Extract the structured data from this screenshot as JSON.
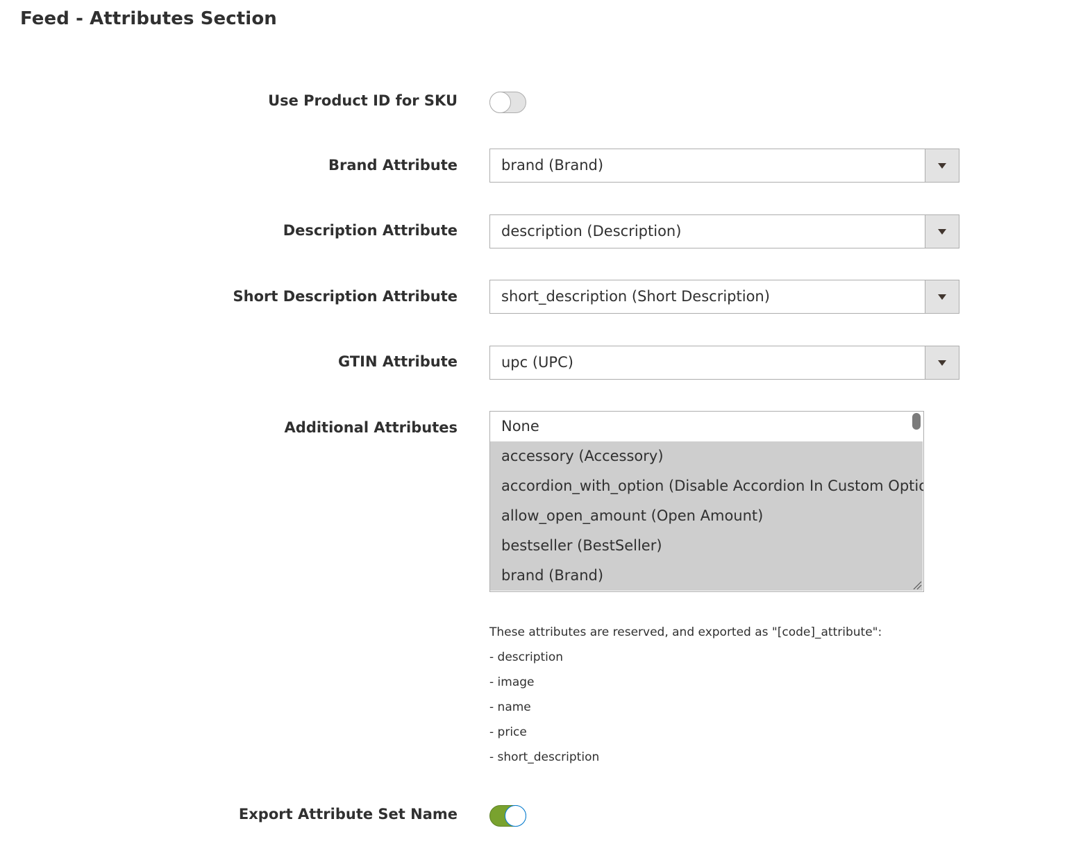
{
  "page": {
    "title": "Feed - Attributes Section"
  },
  "fields": {
    "use_product_id": {
      "label": "Use Product ID for SKU",
      "enabled": false
    },
    "brand": {
      "label": "Brand Attribute",
      "value": "brand (Brand)"
    },
    "description": {
      "label": "Description Attribute",
      "value": "description (Description)"
    },
    "short_description": {
      "label": "Short Description Attribute",
      "value": "short_description (Short Description)"
    },
    "gtin": {
      "label": "GTIN Attribute",
      "value": "upc (UPC)"
    },
    "additional": {
      "label": "Additional Attributes",
      "options": [
        {
          "text": "None",
          "selected": false
        },
        {
          "text": "accessory (Accessory)",
          "selected": true
        },
        {
          "text": "accordion_with_option (Disable Accordion In Custom Option)",
          "selected": true
        },
        {
          "text": "allow_open_amount (Open Amount)",
          "selected": true
        },
        {
          "text": "bestseller (BestSeller)",
          "selected": true
        },
        {
          "text": "brand (Brand)",
          "selected": true
        }
      ]
    },
    "export_attribute_set": {
      "label": "Export Attribute Set Name",
      "enabled": true
    }
  },
  "note": {
    "lines": [
      "These attributes are reserved, and exported as \"[code]_attribute\":",
      "- description",
      "- image",
      "- name",
      "- price",
      "- short_description"
    ]
  },
  "icons": {
    "dropdown": "chevron-down-icon",
    "resize": "resize-grip-icon"
  },
  "colors": {
    "toggle_on": "#79a22e",
    "toggle_off": "#e3e3e3",
    "selected_option": "#cecece",
    "text": "#303030"
  }
}
